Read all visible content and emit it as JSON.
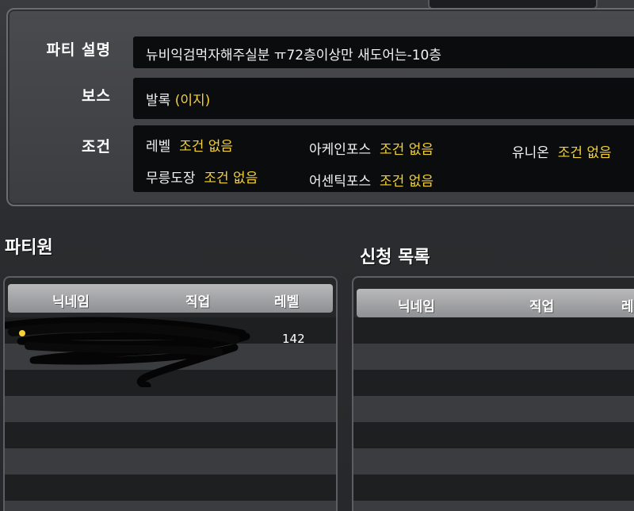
{
  "info": {
    "description_label": "파티 설명",
    "description_value": "뉴비익검먹자해주실분 ㅠ72층이상만 새도어는-10층",
    "boss_label": "보스",
    "boss_name": "발록",
    "boss_difficulty": "(이지)",
    "conditions_label": "조건",
    "conditions": [
      {
        "name": "레벨",
        "value": "조건 없음"
      },
      {
        "name": "아케인포스",
        "value": "조건 없음"
      },
      {
        "name": "유니온",
        "value": "조건 없음"
      },
      {
        "name": "무릉도장",
        "value": "조건 없음"
      },
      {
        "name": "어센틱포스",
        "value": "조건 없음"
      }
    ]
  },
  "members": {
    "title": "파티원",
    "columns": [
      "닉네임",
      "직업",
      "레벨"
    ],
    "rows": [
      {
        "nickname": "",
        "job": "",
        "level": "142"
      }
    ]
  },
  "applicants": {
    "title": "신청 목록",
    "columns": [
      "닉네임",
      "직업",
      "레"
    ]
  },
  "colors": {
    "accent_yellow": "#f4d23a",
    "text_white": "#ffffff"
  }
}
